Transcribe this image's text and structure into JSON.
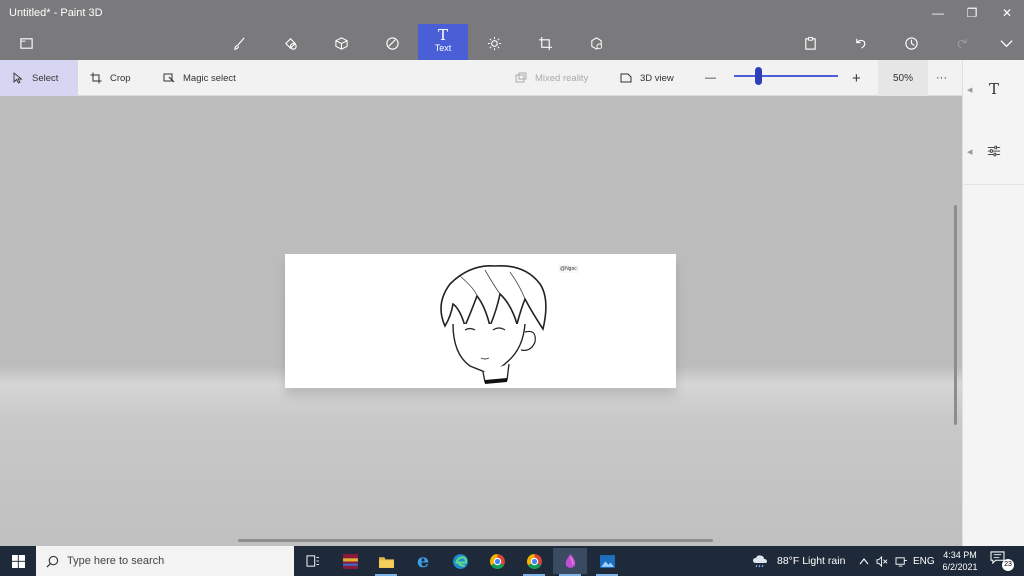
{
  "window": {
    "title": "Untitled* - Paint 3D",
    "minimize_glyph": "—",
    "maximize_glyph": "❐",
    "close_glyph": "✕"
  },
  "toolbar": {
    "active_tool": {
      "glyph": "T",
      "label": "Text"
    },
    "icons": [
      "menu-icon",
      "brushes-icon",
      "2d-shapes-icon",
      "3d-shapes-icon",
      "stickers-icon",
      "text-icon",
      "effects-icon",
      "canvas-icon",
      "3d-library-icon",
      "paste-icon",
      "undo-icon",
      "history-icon",
      "redo-icon",
      "expand-icon"
    ]
  },
  "subbar": {
    "select_label": "Select",
    "crop_label": "Crop",
    "magic_select_label": "Magic select",
    "mixed_reality_label": "Mixed reality",
    "view_3d_label": "3D view",
    "zoom_minus": "—",
    "zoom_plus": "+",
    "zoom_value": "50%",
    "zoom_level": 0.5,
    "more_glyph": "···"
  },
  "right_panel": {
    "text_tool_glyph": "T"
  },
  "canvas": {
    "watermark": "@Ngoc",
    "background": "#ffffff"
  },
  "taskbar": {
    "search_placeholder": "Type here to search",
    "weather": "88°F  Light rain",
    "language": "ENG",
    "time": "4:34 PM",
    "date": "6/2/2021",
    "notification_count": "23"
  },
  "colors": {
    "accent": "#4a5fd6",
    "titlebar": "#7a7a7c",
    "taskbar": "#1e2a3a"
  }
}
